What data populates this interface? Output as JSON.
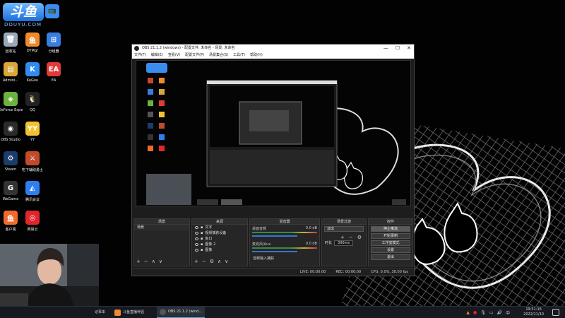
{
  "logo": {
    "mark": "斗鱼",
    "badge": "📺",
    "sub": "DOUYU.COM"
  },
  "desktop_icons": [
    {
      "label": "回收站",
      "icon": "recycle-bin-icon",
      "color": "#9aa8b8",
      "glyph": "🗑"
    },
    {
      "label": "DYMgr",
      "icon": "dymgr-icon",
      "color": "#f08a2c",
      "glyph": "鱼"
    },
    {
      "label": "分组器",
      "icon": "grouper-icon",
      "color": "#3a7de0",
      "glyph": "⊞"
    },
    {
      "label": "Admini...",
      "icon": "admin-folder-icon",
      "color": "#d9a63a",
      "glyph": "▤"
    },
    {
      "label": "KuGou",
      "icon": "kugou-icon",
      "color": "#2f8cf2",
      "glyph": "K"
    },
    {
      "label": "EA",
      "icon": "ea-icon",
      "color": "#e23a3a",
      "glyph": "EA"
    },
    {
      "label": "GeForce Experience",
      "icon": "geforce-icon",
      "color": "#6cb33e",
      "glyph": "◈"
    },
    {
      "label": "QQ",
      "icon": "qq-icon",
      "color": "#222",
      "glyph": "🐧"
    },
    {
      "label": "OBS Studio",
      "icon": "obs-icon",
      "color": "#2a2a2a",
      "glyph": "◉"
    },
    {
      "label": "YY",
      "icon": "yy-icon",
      "color": "#f2c230",
      "glyph": "YY"
    },
    {
      "label": "Steam",
      "icon": "steam-icon",
      "color": "#1b3d6b",
      "glyph": "⚙"
    },
    {
      "label": "吃下辅助勇士",
      "icon": "game-helper-icon",
      "color": "#c04a2a",
      "glyph": "⚔"
    },
    {
      "label": "WeGame",
      "icon": "wegame-icon",
      "color": "#333",
      "glyph": "G"
    },
    {
      "label": "腾讯会议",
      "icon": "tencent-meeting-icon",
      "color": "#2e7ef0",
      "glyph": "◭"
    },
    {
      "label": "客户端",
      "icon": "client-icon",
      "color": "#f06a2c",
      "glyph": "鱼"
    },
    {
      "label": "网易云",
      "icon": "netease-music-icon",
      "color": "#e0262c",
      "glyph": "◎"
    }
  ],
  "obs": {
    "title": "OBS 21.1.2 (windows) - 配置文件: 未命名 - 场景: 未命名",
    "menu": [
      "文件(F)",
      "编辑(E)",
      "查看(V)",
      "配置文件(P)",
      "场景集合(S)",
      "工具(T)",
      "帮助(H)"
    ],
    "window_buttons": [
      "—",
      "☐",
      "✕"
    ],
    "scenes_header": "场景",
    "scene_items": [
      "场景"
    ],
    "sources_header": "来源",
    "sources": [
      "文字",
      "视频捕获设备",
      "窗口",
      "图像 2",
      "图像"
    ],
    "mixer_header": "混音器",
    "mixer": [
      {
        "name": "桌面音频",
        "db": "0.0 dB"
      },
      {
        "name": "麦克风/Aux",
        "db": "0.0 dB"
      }
    ],
    "mixer_extra": "音频输入捕获",
    "transitions_header": "场景过渡",
    "transition_value": "淡出",
    "duration_label": "时长",
    "duration_value": "300ms",
    "controls_header": "控件",
    "controls": [
      "停止推流",
      "开始录制",
      "工作室模式",
      "设置",
      "退出"
    ],
    "status": {
      "live": "LIVE: 00:00:00",
      "rec": "REC: 00:00:00",
      "cpu": "CPU: 0.0%, 30.00 fps"
    }
  },
  "taskbar": {
    "items": [
      {
        "label": "记事本",
        "icon": "notepad-icon",
        "color": "#4a90d9"
      },
      {
        "label": "斗鱼直播伴侣",
        "icon": "douyu-companion-icon",
        "color": "#f08a2c"
      },
      {
        "label": "OBS 21.1.2 (wind...",
        "icon": "obs-taskbar-icon",
        "color": "#555"
      }
    ],
    "time": "19:51:16",
    "date": "2022/11/10"
  }
}
